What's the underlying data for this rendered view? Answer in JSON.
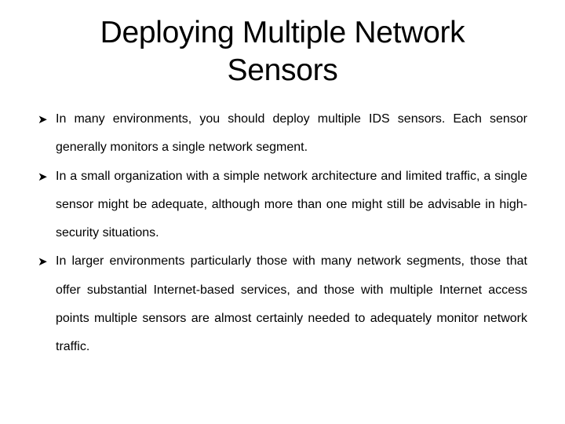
{
  "slide": {
    "title": "Deploying Multiple Network Sensors",
    "bullet_icon": "arrow-bullet-icon",
    "bullets": [
      {
        "text": "In many environments, you should deploy multiple IDS sensors. Each sensor generally monitors a single network segment."
      },
      {
        "text": "In a small organization with a simple network architecture and limited traffic, a single sensor might be adequate, although more than one might still be advisable in high-security situations."
      },
      {
        "text": " In larger environments particularly those with many network segments, those that offer substantial Internet-based services, and those with multiple Internet access points multiple sensors are almost certainly needed to adequately monitor network traffic."
      }
    ]
  }
}
